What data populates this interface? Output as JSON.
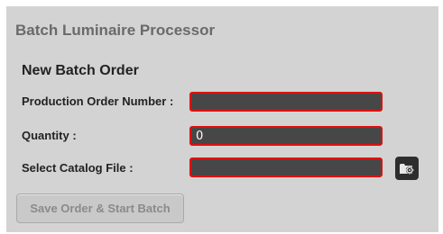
{
  "app": {
    "title": "Batch Luminaire Processor"
  },
  "form": {
    "section_title": "New Batch Order",
    "fields": [
      {
        "label": "Production Order Number :",
        "value": ""
      },
      {
        "label": "Quantity :",
        "value": "0"
      },
      {
        "label": "Select Catalog File :",
        "value": ""
      }
    ],
    "browse_icon": "folder-gear-icon",
    "save_label": "Save Order & Start Batch"
  },
  "colors": {
    "panel_bg": "#d3d3d3",
    "field_bg": "#474747",
    "field_border_error": "#e01010",
    "disabled_text": "#8a8a8a"
  }
}
